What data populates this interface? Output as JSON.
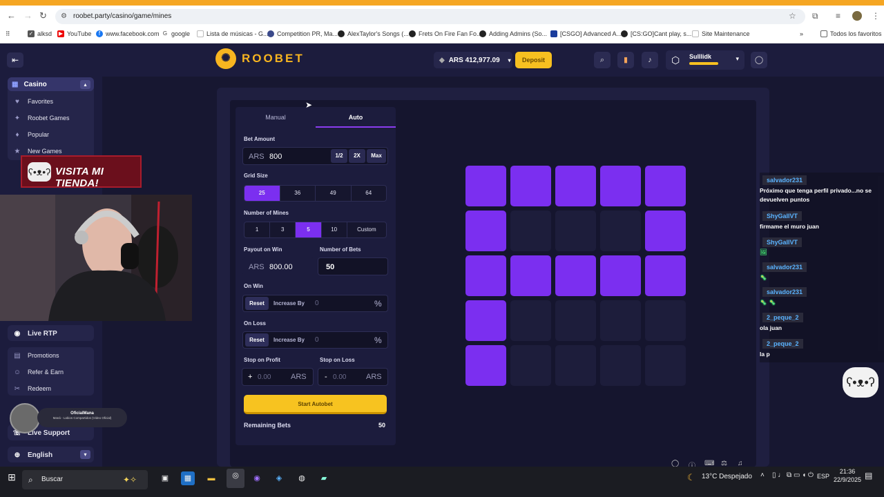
{
  "browser": {
    "url": "roobet.party/casino/game/mines",
    "bookmarks": [
      "alksd",
      "YouTube",
      "www.facebook.com",
      "google",
      "Lista de músicas - G...",
      "Competition PR, Ma...",
      "AlexTaylor's Songs (...",
      "Frets On Fire Fan Fo...",
      "Adding Admins (So...",
      "[CSGO] Advanced A...",
      "[CS:GO]Cant play, s...",
      "Site Maintenance"
    ],
    "all_bookmarks": "Todos los favoritos"
  },
  "header": {
    "logo": "ROOBET",
    "balance": "ARS 412,977.09",
    "deposit": "Deposit",
    "username": "Sulllidk"
  },
  "sidebar": {
    "casino": "Casino",
    "items": [
      "Favorites",
      "Roobet Games",
      "Popular",
      "New Games"
    ],
    "live_rtp": "Live RTP",
    "promotions": "Promotions",
    "refer": "Refer & Earn",
    "redeem": "Redeem",
    "live_support": "Live Support",
    "language": "English"
  },
  "overlay": {
    "promo": "VISITA MI TIENDA!",
    "song_artist": "OficialMana",
    "song_title": "Maná - Labios Compartidos (Video Oficial)"
  },
  "game": {
    "tabs": [
      "Manual",
      "Auto"
    ],
    "bet_amount_label": "Bet Amount",
    "currency": "ARS",
    "bet_amount": "800",
    "bet_mods": [
      "1/2",
      "2X",
      "Max"
    ],
    "grid_size_label": "Grid Size",
    "grid_sizes": [
      "25",
      "36",
      "49",
      "64"
    ],
    "mines_label": "Number of Mines",
    "mines": [
      "1",
      "3",
      "5",
      "10",
      "Custom"
    ],
    "payout_label": "Payout on Win",
    "payout": "800.00",
    "num_bets_label": "Number of Bets",
    "num_bets": "50",
    "on_win_label": "On Win",
    "on_loss_label": "On Loss",
    "reset": "Reset",
    "increase_by": "Increase By",
    "zero": "0",
    "percent": "%",
    "stop_profit_label": "Stop on Profit",
    "stop_loss_label": "Stop on Loss",
    "plus": "+",
    "minus": "-",
    "stop_placeholder": "0.00",
    "start": "Start Autobet",
    "remaining_label": "Remaining Bets",
    "remaining": "50",
    "tiles_selected": [
      1,
      1,
      1,
      1,
      1,
      1,
      0,
      0,
      0,
      1,
      1,
      1,
      1,
      1,
      1,
      1,
      0,
      0,
      0,
      0,
      1,
      0,
      0,
      0,
      0
    ],
    "accent": "#7b2ff0"
  },
  "chat": [
    {
      "user": "salvador231",
      "msg": "Próximo que tenga perfil privado...no se devuelven puntos"
    },
    {
      "user": "ShyGallVT",
      "msg": "firmame el muro juan"
    },
    {
      "user": "ShyGallVT",
      "msg": "🖼"
    },
    {
      "user": "salvador231",
      "msg": "🦠"
    },
    {
      "user": "salvador231",
      "msg": "🦠 🦠"
    },
    {
      "user": "2_peque_2",
      "msg": "ola juan"
    },
    {
      "user": "2_peque_2",
      "msg": "la p"
    }
  ],
  "taskbar": {
    "search": "Buscar",
    "weather": "13°C  Despejado",
    "lang": "ESP",
    "time": "21:36",
    "date": "22/9/2025"
  }
}
